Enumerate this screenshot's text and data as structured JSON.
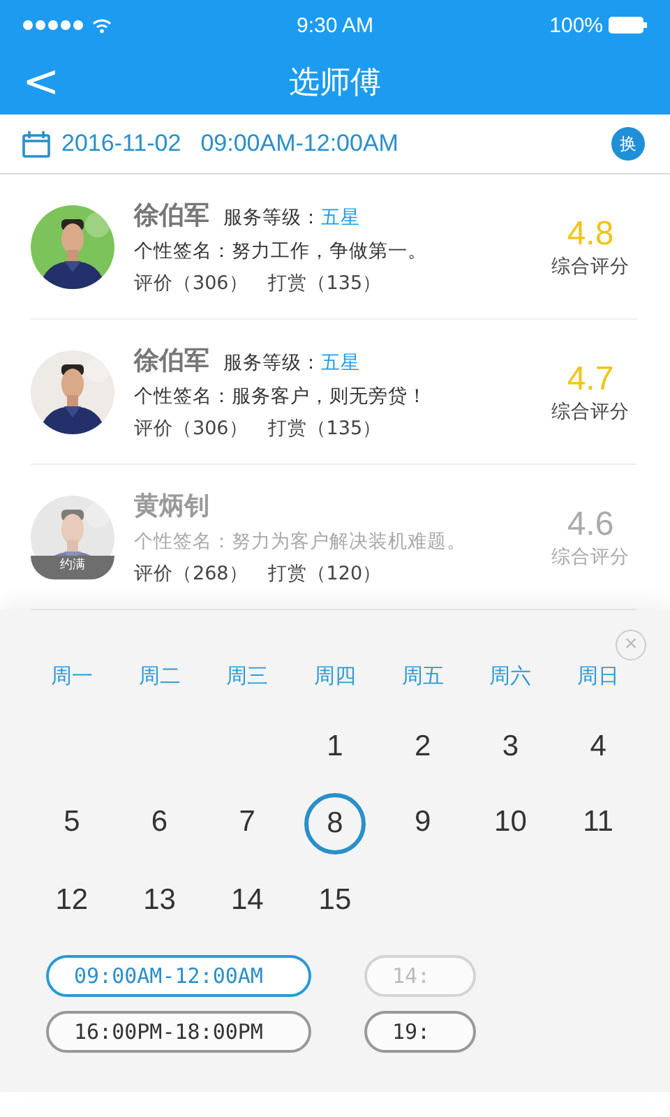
{
  "status_bar": {
    "time": "9:30 AM",
    "battery": "100%"
  },
  "nav": {
    "back": "<",
    "title": "选师傅"
  },
  "booking": {
    "date": "2016-11-02",
    "time": "09:00AM-12:00AM",
    "switch": "换"
  },
  "masters": [
    {
      "name": "徐伯军",
      "level_label": "服务等级：",
      "level": "五星",
      "signature": "个性签名：努力工作，争做第一。",
      "reviews": "评价（306）",
      "tips": "打赏（135）",
      "score": "4.8",
      "score_label": "综合评分",
      "disabled": false
    },
    {
      "name": "徐伯军",
      "level_label": "服务等级：",
      "level": "五星",
      "signature": "个性签名：服务客户，则无旁贷！",
      "reviews": "评价（306）",
      "tips": "打赏（135）",
      "score": "4.7",
      "score_label": "综合评分",
      "disabled": false
    },
    {
      "name": "黄炳钊",
      "signature": "个性签名：努力为客户解决装机难题。",
      "reviews": "评价（268）",
      "tips": "打赏（120）",
      "score": "4.6",
      "score_label": "综合评分",
      "disabled": true,
      "badge": "约满"
    }
  ],
  "calendar": {
    "close": "×",
    "weekdays": [
      "周一",
      "周二",
      "周三",
      "周四",
      "周五",
      "周六",
      "周日"
    ],
    "days": [
      {
        "label": "1",
        "selected": false
      },
      {
        "label": "2",
        "selected": false
      },
      {
        "label": "3",
        "selected": false
      },
      {
        "label": "4",
        "selected": false
      },
      {
        "label": "5",
        "selected": false
      },
      {
        "label": "6",
        "selected": false
      },
      {
        "label": "7",
        "selected": false
      },
      {
        "label": "8",
        "selected": true
      },
      {
        "label": "9",
        "selected": false
      },
      {
        "label": "10",
        "selected": false
      },
      {
        "label": "11",
        "selected": false
      },
      {
        "label": "12",
        "selected": false
      },
      {
        "label": "13",
        "selected": false
      },
      {
        "label": "14",
        "selected": false
      },
      {
        "label": "15",
        "selected": false
      }
    ],
    "slots": [
      {
        "label": "09:00AM-12:00AM",
        "selected": true,
        "disabled": false
      },
      {
        "label": "14:",
        "selected": false,
        "disabled": true
      },
      {
        "label": "16:00PM-18:00PM",
        "selected": false,
        "disabled": false
      },
      {
        "label": "19:",
        "selected": false,
        "disabled": false
      }
    ]
  }
}
